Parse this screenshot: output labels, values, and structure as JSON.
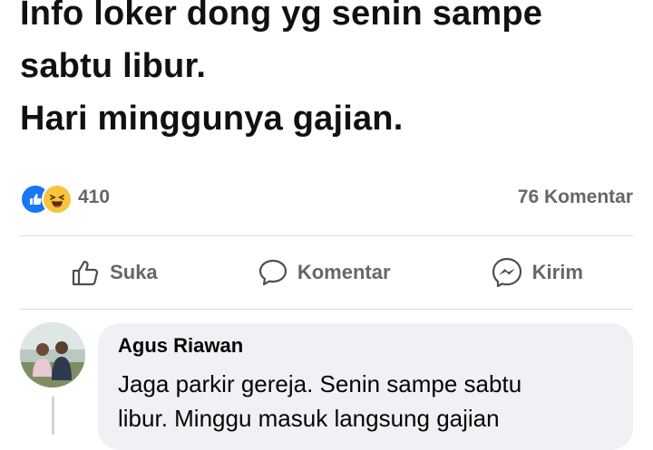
{
  "post": {
    "lines": [
      "Info loker dong yg senin sampe",
      "sabtu libur.",
      "Hari minggunya gajian."
    ]
  },
  "stats": {
    "reactions": [
      "like-icon",
      "haha-icon"
    ],
    "reaction_count": "410",
    "comment_count": "76 Komentar"
  },
  "actions": {
    "like_label": "Suka",
    "comment_label": "Komentar",
    "send_label": "Kirim"
  },
  "comment": {
    "author": "Agus Riawan",
    "lines": [
      "Jaga parkir gereja. Senin sampe sabtu",
      "libur. Minggu masuk langsung gajian"
    ]
  },
  "colors": {
    "like_blue": "#1877f2",
    "haha_yellow": "#f7c43b",
    "muted_text": "#65676b",
    "bubble_bg": "#eff1f4"
  }
}
